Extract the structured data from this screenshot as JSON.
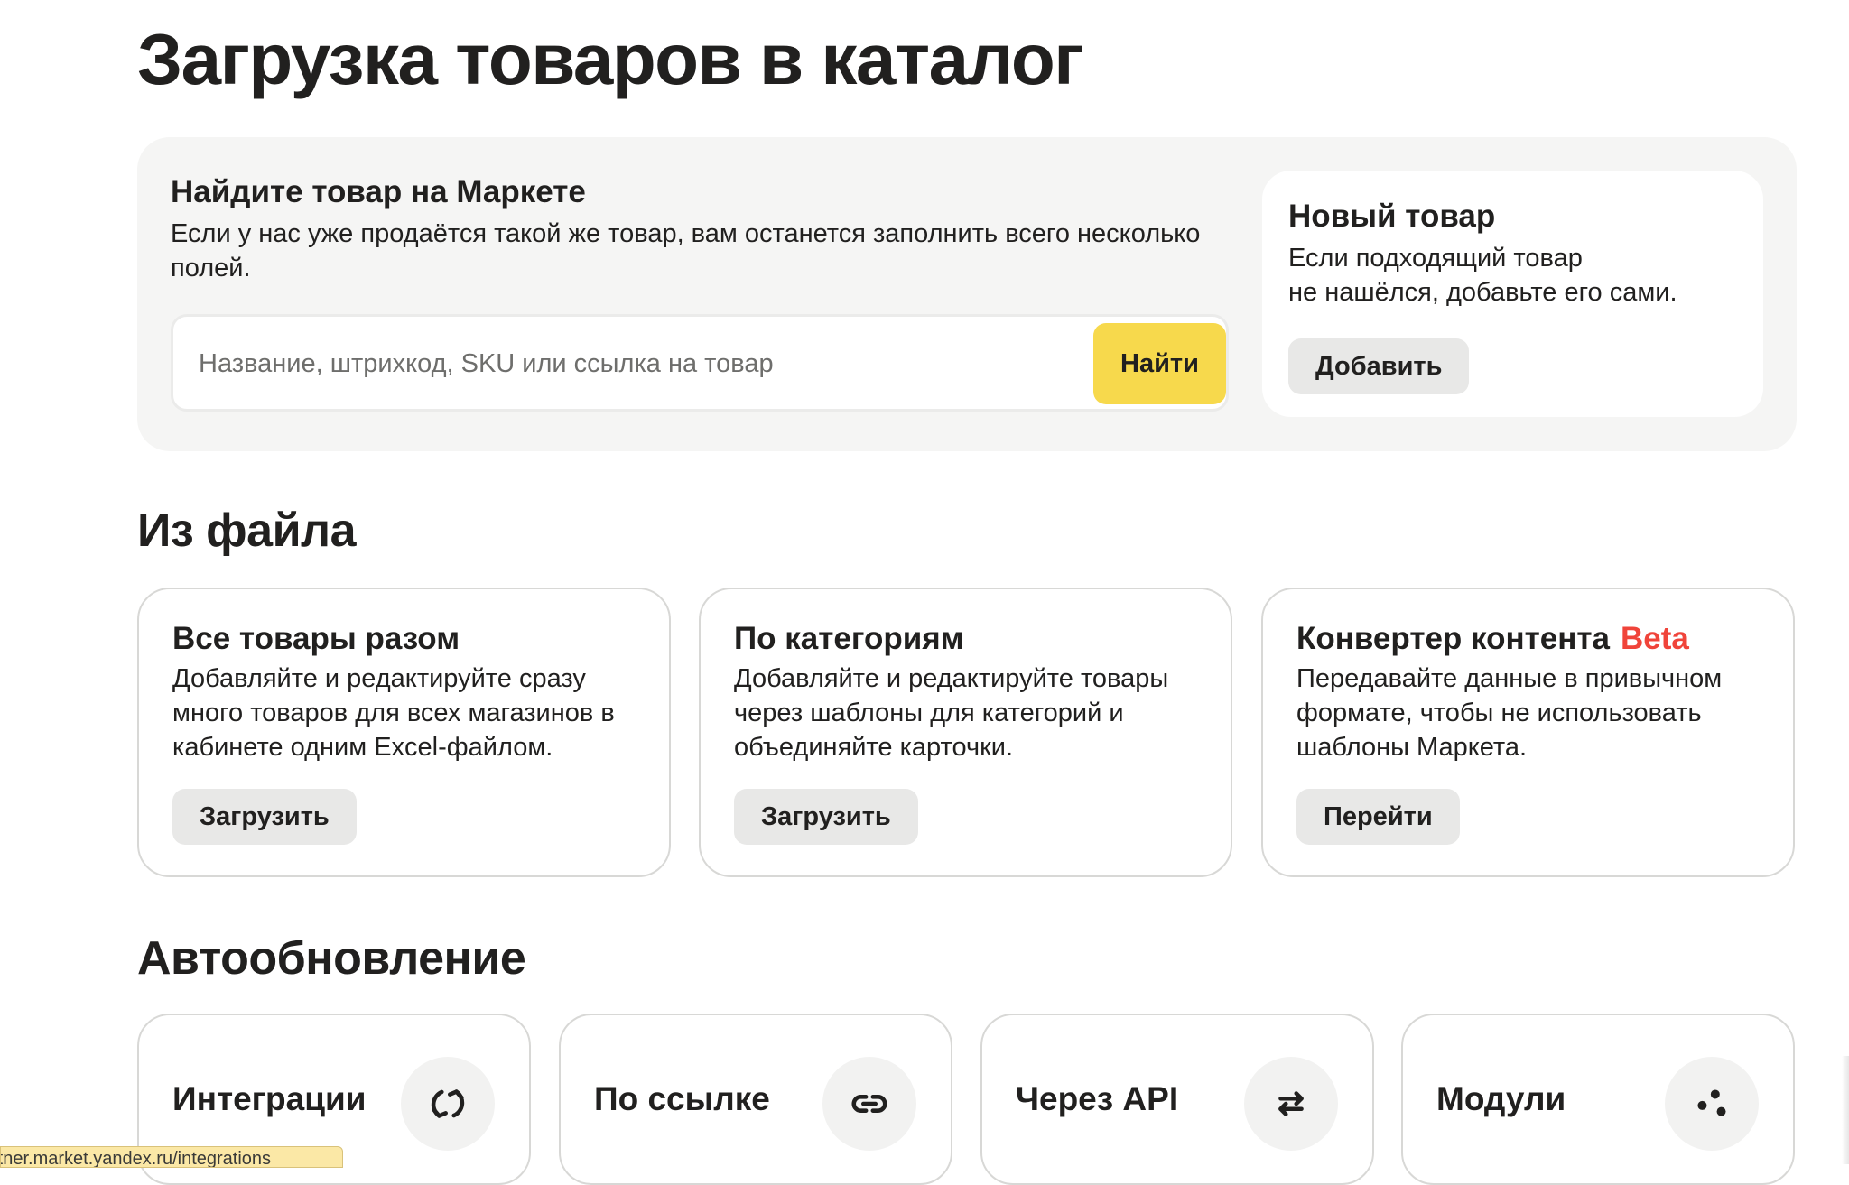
{
  "page": {
    "title": "Загрузка товаров в каталог"
  },
  "find": {
    "title": "Найдите товар на Маркете",
    "description": "Если у нас уже продаётся такой же товар, вам останется заполнить всего несколько полей.",
    "search_placeholder": "Название, штрихкод, SKU или ссылка на товар",
    "search_value": "",
    "button_label": "Найти",
    "button_color": "#f7d94c"
  },
  "new_product": {
    "title": "Новый товар",
    "description_line1": "Если подходящий товар",
    "description_line2": "не нашёлся, добавьте его сами.",
    "button_label": "Добавить"
  },
  "from_file": {
    "title": "Из файла",
    "cards": [
      {
        "title": "Все товары разом",
        "description": "Добавляйте и редактируйте сразу много товаров для всех магазинов в кабинете одним Excel-файлом.",
        "button_label": "Загрузить"
      },
      {
        "title": "По категориям",
        "description": "Добавляйте и редактируйте товары через шаблоны для категорий и объединяйте карточки.",
        "button_label": "Загрузить"
      },
      {
        "title": "Конвертер контента",
        "badge": "Beta",
        "badge_color": "#f0443a",
        "description": "Передавайте данные в привычном формате, чтобы не использовать шаблоны Маркета.",
        "button_label": "Перейти"
      }
    ]
  },
  "auto_update": {
    "title": "Автообновление",
    "cards": [
      {
        "label": "Интеграции",
        "icon": "refresh-icon"
      },
      {
        "label": "По ссылке",
        "icon": "link-icon"
      },
      {
        "label": "Через API",
        "icon": "swap-arrows-icon"
      },
      {
        "label": "Модули",
        "icon": "modules-dots-icon"
      }
    ]
  },
  "status_bar": {
    "url": "rtner.market.yandex.ru/integrations"
  }
}
